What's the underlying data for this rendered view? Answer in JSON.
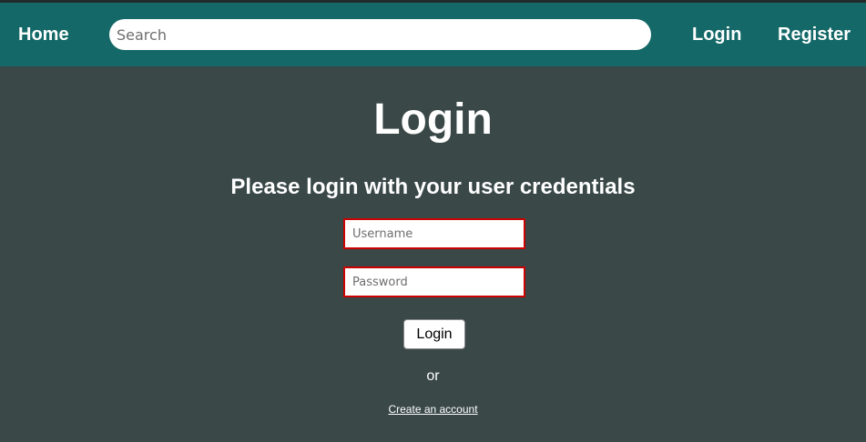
{
  "navbar": {
    "home_label": "Home",
    "search_placeholder": "Search",
    "search_value": "",
    "login_label": "Login",
    "register_label": "Register"
  },
  "login_form": {
    "title": "Login",
    "subtitle": "Please login with your user credentials",
    "username_placeholder": "Username",
    "username_value": "",
    "password_placeholder": "Password",
    "password_value": "",
    "submit_label": "Login",
    "separator_text": "or",
    "create_account_label": "Create an account"
  },
  "colors": {
    "navbar_background": "#146868",
    "page_background": "#3a4848",
    "field_border_error": "#cc0000",
    "text": "#ffffff"
  }
}
